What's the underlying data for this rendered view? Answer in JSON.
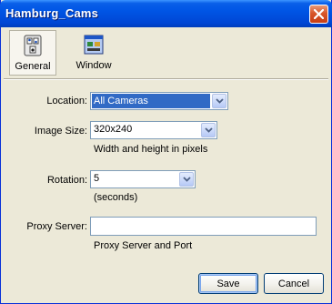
{
  "window": {
    "title": "Hamburg_Cams"
  },
  "toolbar": {
    "tabs": [
      {
        "label": "General",
        "icon": "settings-switches-icon",
        "selected": true
      },
      {
        "label": "Window",
        "icon": "window-icon",
        "selected": false
      }
    ]
  },
  "form": {
    "location": {
      "label": "Location:",
      "value": "All Cameras"
    },
    "image_size": {
      "label": "Image Size:",
      "value": "320x240",
      "hint": "Width and height in pixels"
    },
    "rotation": {
      "label": "Rotation:",
      "value": "5",
      "hint": "(seconds)"
    },
    "proxy": {
      "label": "Proxy Server:",
      "value": "",
      "hint": "Proxy Server and Port"
    }
  },
  "buttons": {
    "save": "Save",
    "cancel": "Cancel"
  }
}
